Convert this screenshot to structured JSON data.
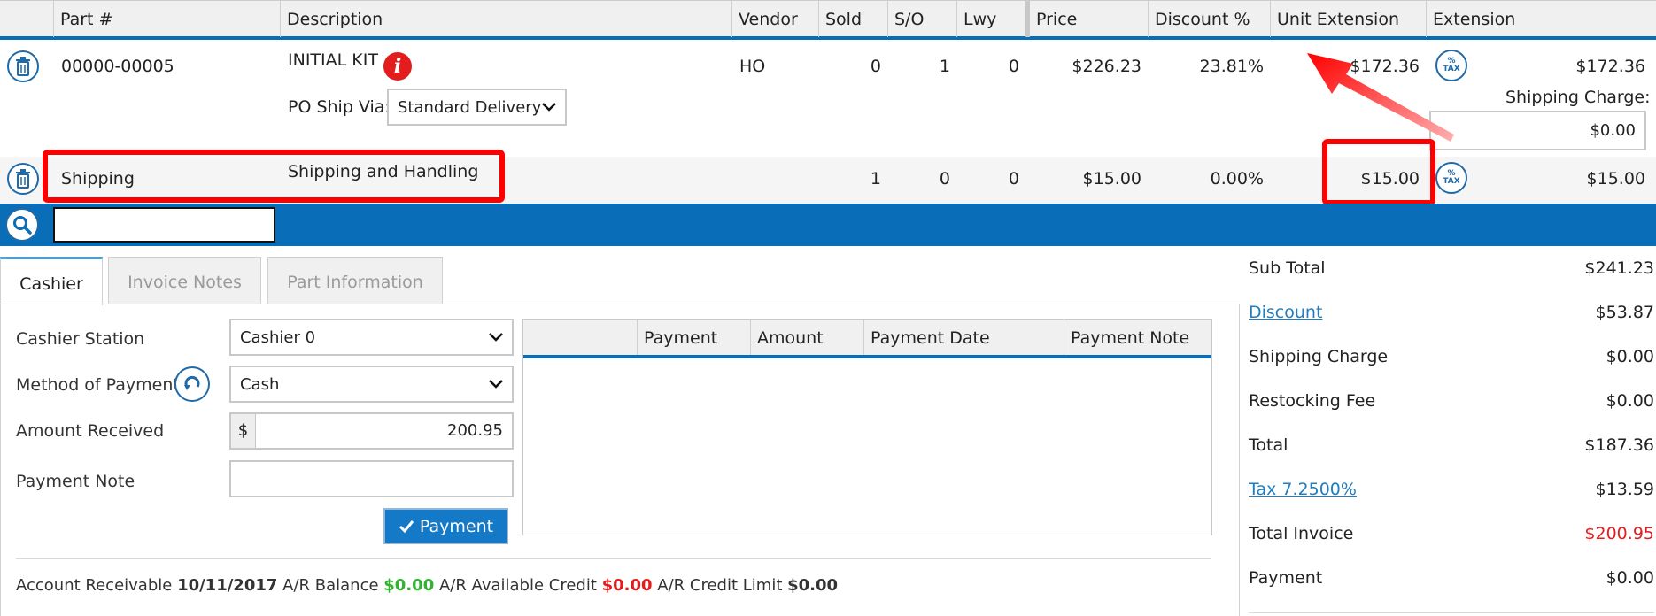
{
  "grid": {
    "headers": [
      "Part #",
      "Description",
      "Vendor",
      "Sold",
      "S/O",
      "Lwy",
      "Price",
      "Discount %",
      "Unit Extension",
      "Extension"
    ],
    "rows": [
      {
        "part": "00000-00005",
        "description": "INITIAL KIT",
        "vendor": "HO",
        "sold": "0",
        "so": "1",
        "lwy": "0",
        "price": "$226.23",
        "discount": "23.81%",
        "unit_ext": "$172.36",
        "extension": "$172.36",
        "po_ship_label": "PO Ship Via:",
        "po_ship_value": "Standard Delivery",
        "shipping_charge_label": "Shipping Charge:",
        "shipping_charge_value": "$0.00"
      },
      {
        "part": "Shipping",
        "description": "Shipping and Handling",
        "vendor": "",
        "sold": "1",
        "so": "0",
        "lwy": "0",
        "price": "$15.00",
        "discount": "0.00%",
        "unit_ext": "$15.00",
        "extension": "$15.00"
      }
    ],
    "tax_icon_text": "TAX"
  },
  "tabs": [
    "Cashier",
    "Invoice Notes",
    "Part Information"
  ],
  "cashier": {
    "station_label": "Cashier Station",
    "station_value": "Cashier 0",
    "method_label": "Method of Payment",
    "method_value": "Cash",
    "amount_label": "Amount Received",
    "currency": "$",
    "amount_value": "200.95",
    "note_label": "Payment Note",
    "payment_button": "Payment"
  },
  "payment_grid": {
    "headers": [
      "Payment",
      "Amount",
      "Payment Date",
      "Payment Note"
    ]
  },
  "ar": {
    "label": "Account Receivable",
    "date": "10/11/2017",
    "balance_label": "A/R Balance",
    "balance": "$0.00",
    "available_label": "A/R Available Credit",
    "available": "$0.00",
    "limit_label": "A/R Credit Limit",
    "limit": "$0.00"
  },
  "summary": {
    "sub_total_label": "Sub Total",
    "sub_total": "$241.23",
    "discount_label": "Discount",
    "discount": "$53.87",
    "shipping_label": "Shipping Charge",
    "shipping": "$0.00",
    "restocking_label": "Restocking Fee",
    "restocking": "$0.00",
    "total_label": "Total",
    "total": "$187.36",
    "tax_label": "Tax 7.2500%",
    "tax": "$13.59",
    "total_invoice_label": "Total Invoice",
    "total_invoice": "$200.95",
    "payment_label": "Payment",
    "payment": "$0.00"
  },
  "colors": {
    "accent_blue": "#0a6db8",
    "highlight_red": "#ff0000",
    "green": "#33b233"
  }
}
